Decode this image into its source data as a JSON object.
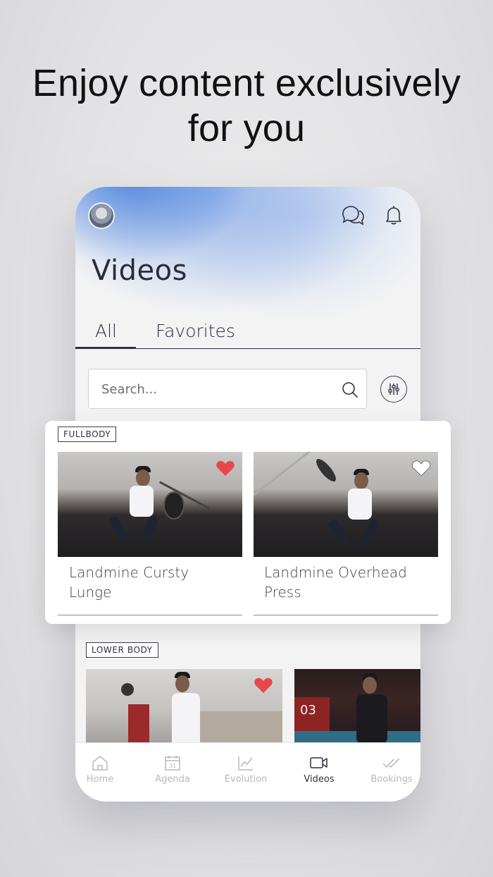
{
  "headline": {
    "line1": "Enjoy content exclusively",
    "line2": "for you"
  },
  "app": {
    "page_title": "Videos",
    "tabs": [
      {
        "label": "All",
        "active": true
      },
      {
        "label": "Favorites",
        "active": false
      }
    ],
    "search": {
      "placeholder": "Search..."
    },
    "sections": [
      {
        "badge": "FULLBODY",
        "videos": [
          {
            "title_line1": "Landmine Cursty",
            "title_line2": "Lunge",
            "favorite": true
          },
          {
            "title_line1": "Landmine Overhead",
            "title_line2": "Press",
            "favorite": false
          }
        ]
      },
      {
        "badge": "LOWER BODY",
        "videos": [
          {
            "favorite": true
          },
          {
            "favorite": false
          }
        ]
      }
    ],
    "nav": [
      {
        "label": "Home",
        "icon": "home-icon",
        "active": false
      },
      {
        "label": "Agenda",
        "icon": "calendar-icon",
        "active": false
      },
      {
        "label": "Evolution",
        "icon": "chart-icon",
        "active": false
      },
      {
        "label": "Videos",
        "icon": "video-icon",
        "active": true
      },
      {
        "label": "Bookings",
        "icon": "double-check-icon",
        "active": false
      }
    ],
    "calendar_day": "31"
  },
  "colors": {
    "accent_dark": "#2e3040",
    "heart_red": "#e9464c",
    "glow_blue": "#4a82de"
  }
}
